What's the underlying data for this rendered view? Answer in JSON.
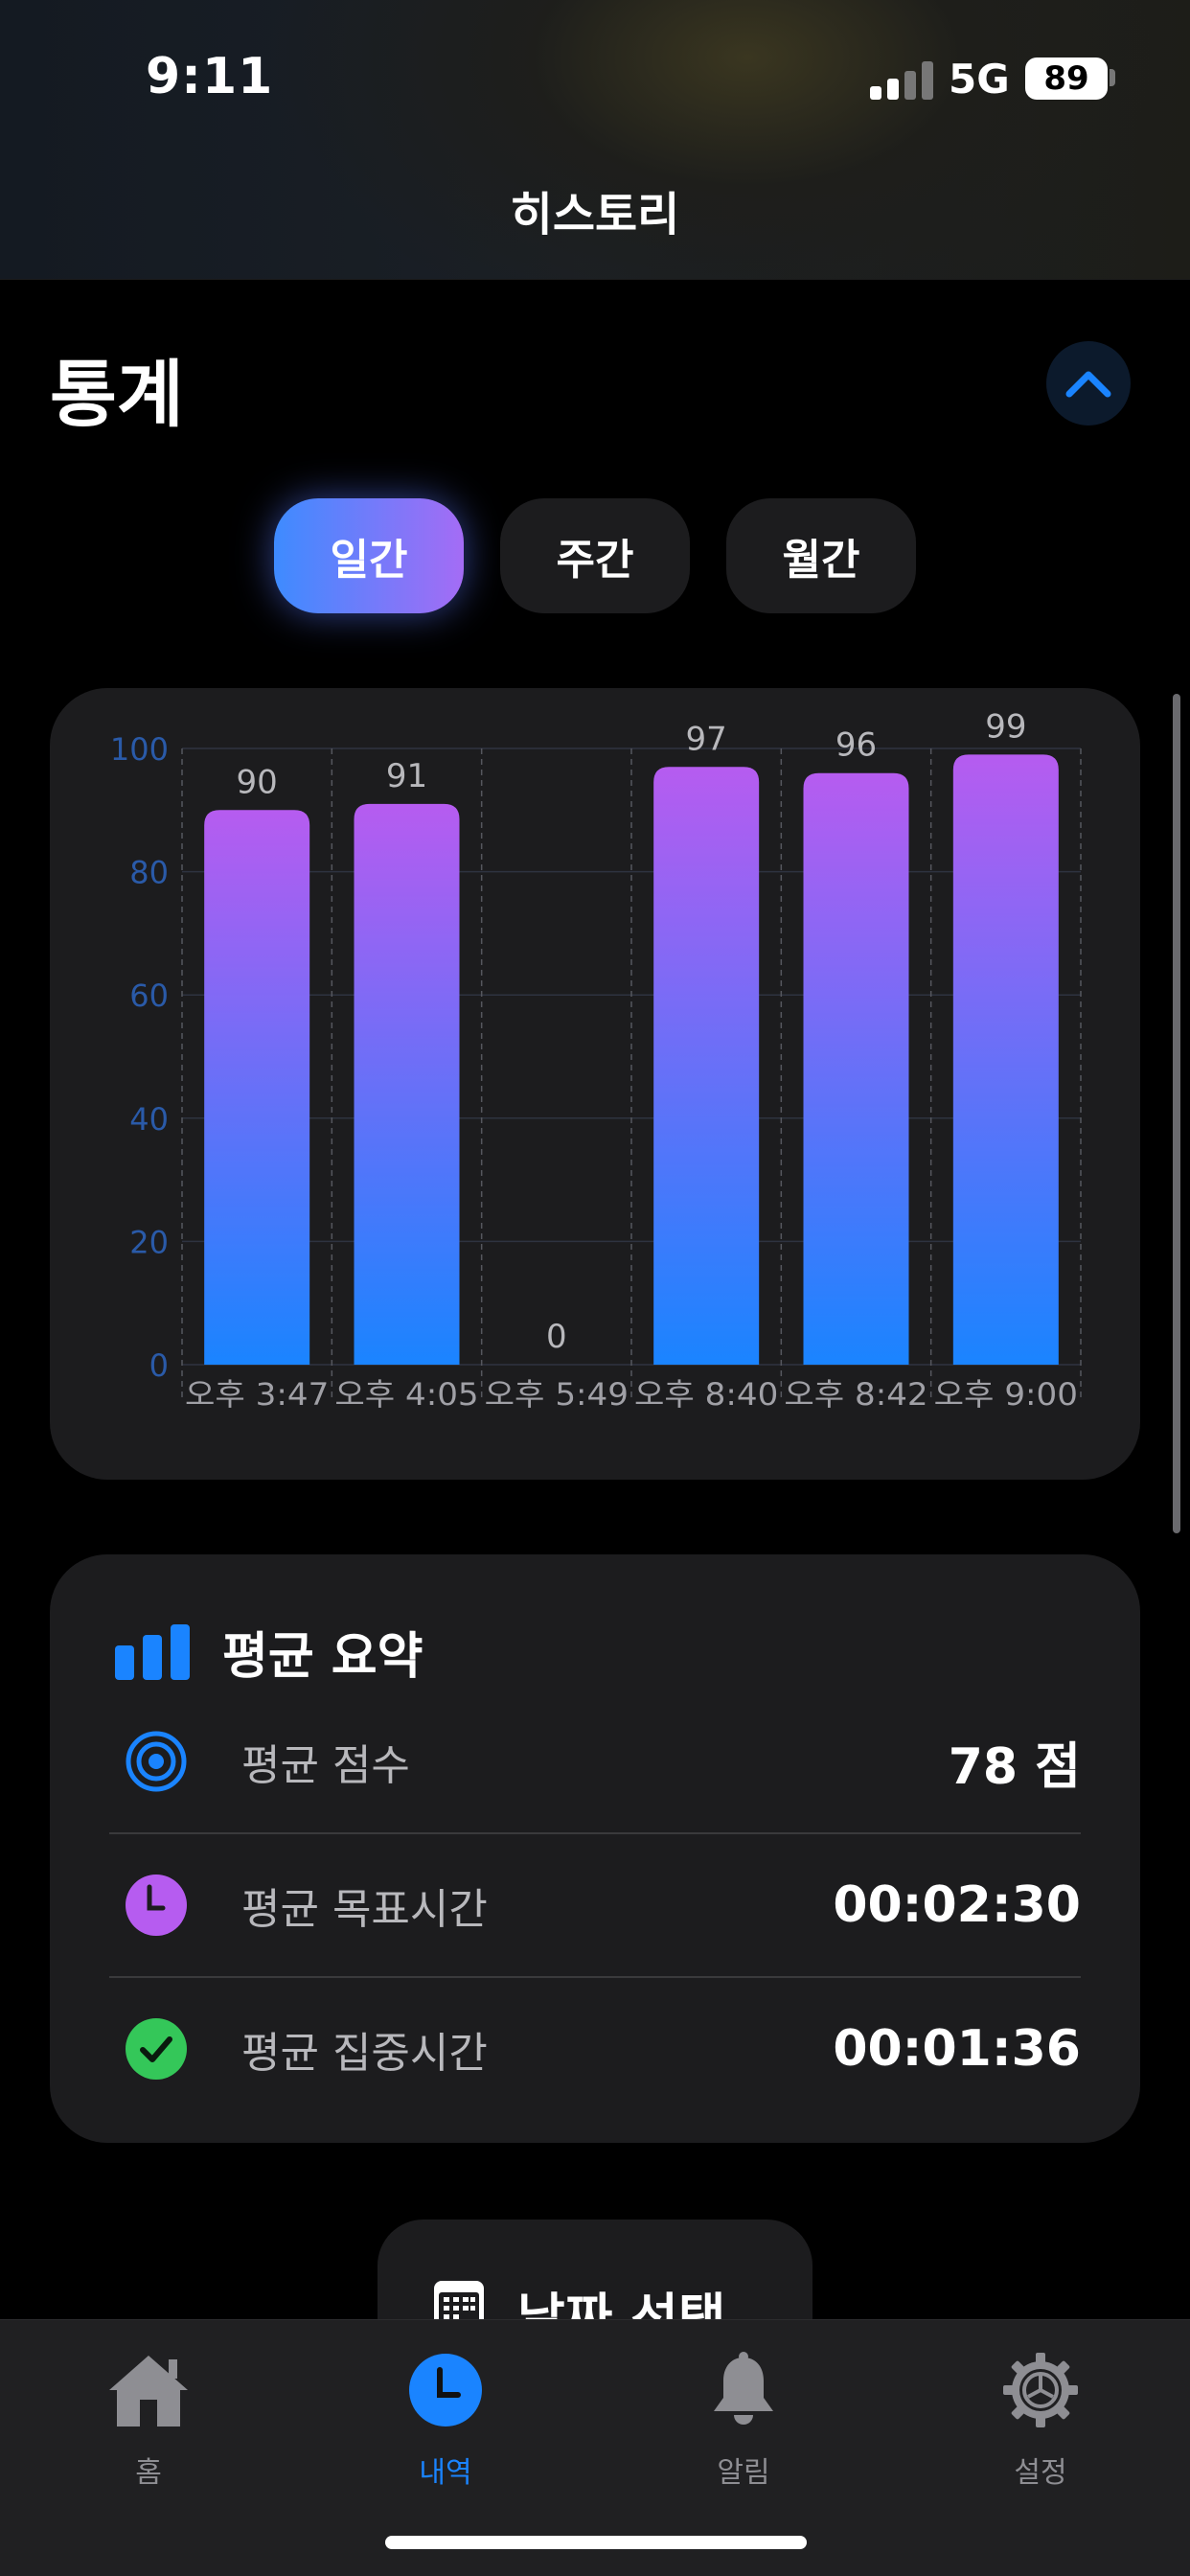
{
  "status_bar": {
    "time": "9:11",
    "carrier": "5G",
    "battery": "89"
  },
  "nav": {
    "title": "히스토리"
  },
  "stats": {
    "title": "통계"
  },
  "segments": [
    {
      "label": "일간",
      "active": true
    },
    {
      "label": "주간",
      "active": false
    },
    {
      "label": "월간",
      "active": false
    }
  ],
  "chart_data": {
    "type": "bar",
    "categories": [
      "오후 3:47",
      "오후 4:05",
      "오후 5:49",
      "오후 8:40",
      "오후 8:42",
      "오후 9:00"
    ],
    "values": [
      90,
      91,
      0,
      97,
      96,
      99
    ],
    "ylim": [
      0,
      100
    ],
    "yticks": [
      0,
      20,
      40,
      60,
      80,
      100
    ],
    "grid": true,
    "bar_gradient": [
      "#1a84ff",
      "#b65cf0"
    ]
  },
  "summary": {
    "title": "평균 요약",
    "rows": [
      {
        "label": "평균 점수",
        "value": "78 점",
        "icon": "target-icon",
        "color": "#1a84ff"
      },
      {
        "label": "평균 목표시간",
        "value": "00:02:30",
        "icon": "clock-icon",
        "color": "#b65cf0"
      },
      {
        "label": "평균 집중시간",
        "value": "00:01:36",
        "icon": "check-circle-icon",
        "color": "#34c759"
      }
    ]
  },
  "date_button": {
    "label": "날짜 선택"
  },
  "tabs": [
    {
      "label": "홈",
      "icon": "home-icon",
      "active": false
    },
    {
      "label": "내역",
      "icon": "clock-icon",
      "active": true
    },
    {
      "label": "알림",
      "icon": "bell-icon",
      "active": false
    },
    {
      "label": "설정",
      "icon": "gear-icon",
      "active": false
    }
  ]
}
